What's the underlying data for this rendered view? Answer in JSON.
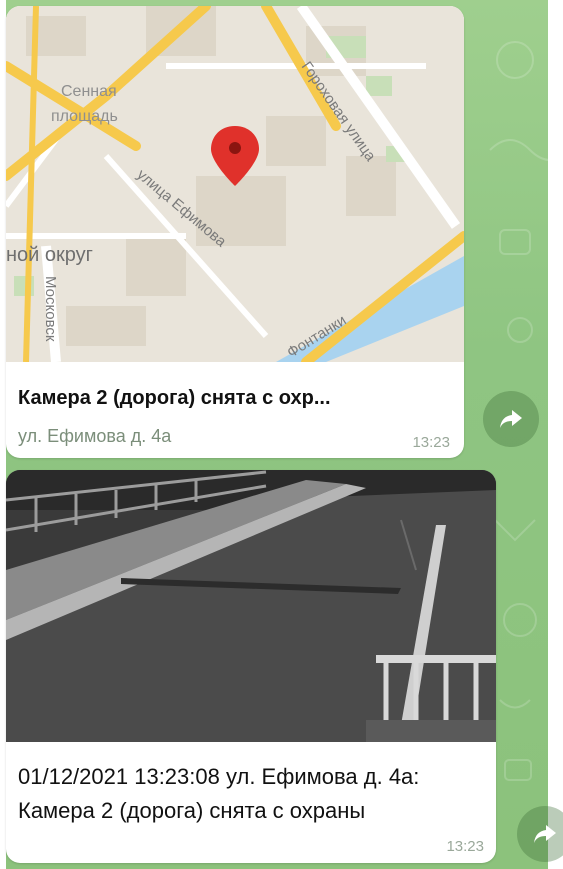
{
  "messages": [
    {
      "type": "location",
      "map_labels": {
        "sennaya": "Сенная площадь",
        "sennaya_line1": "Сенная",
        "sennaya_line2": "площадь",
        "district": "ной округ",
        "moskovsky": "Московск",
        "efimova": "улица Ефимова",
        "gorokhovaya": "Гороховая улица",
        "fontanki": "Фонтанки"
      },
      "title": "Камера 2 (дорога) снята с охр...",
      "address": "ул. Ефимова д. 4а",
      "time": "13:23"
    },
    {
      "type": "photo",
      "caption": "01/12/2021 13:23:08 ул. Ефимова д. 4а: Камера 2 (дорога) снята с охраны",
      "time": "13:23"
    }
  ],
  "icons": {
    "forward": "forward-arrow-icon",
    "pin": "map-pin-icon"
  },
  "colors": {
    "chat_background": "#8fc582",
    "pin": "#e0312b",
    "road_major": "#f6c94c",
    "water": "#a9d3ef"
  }
}
